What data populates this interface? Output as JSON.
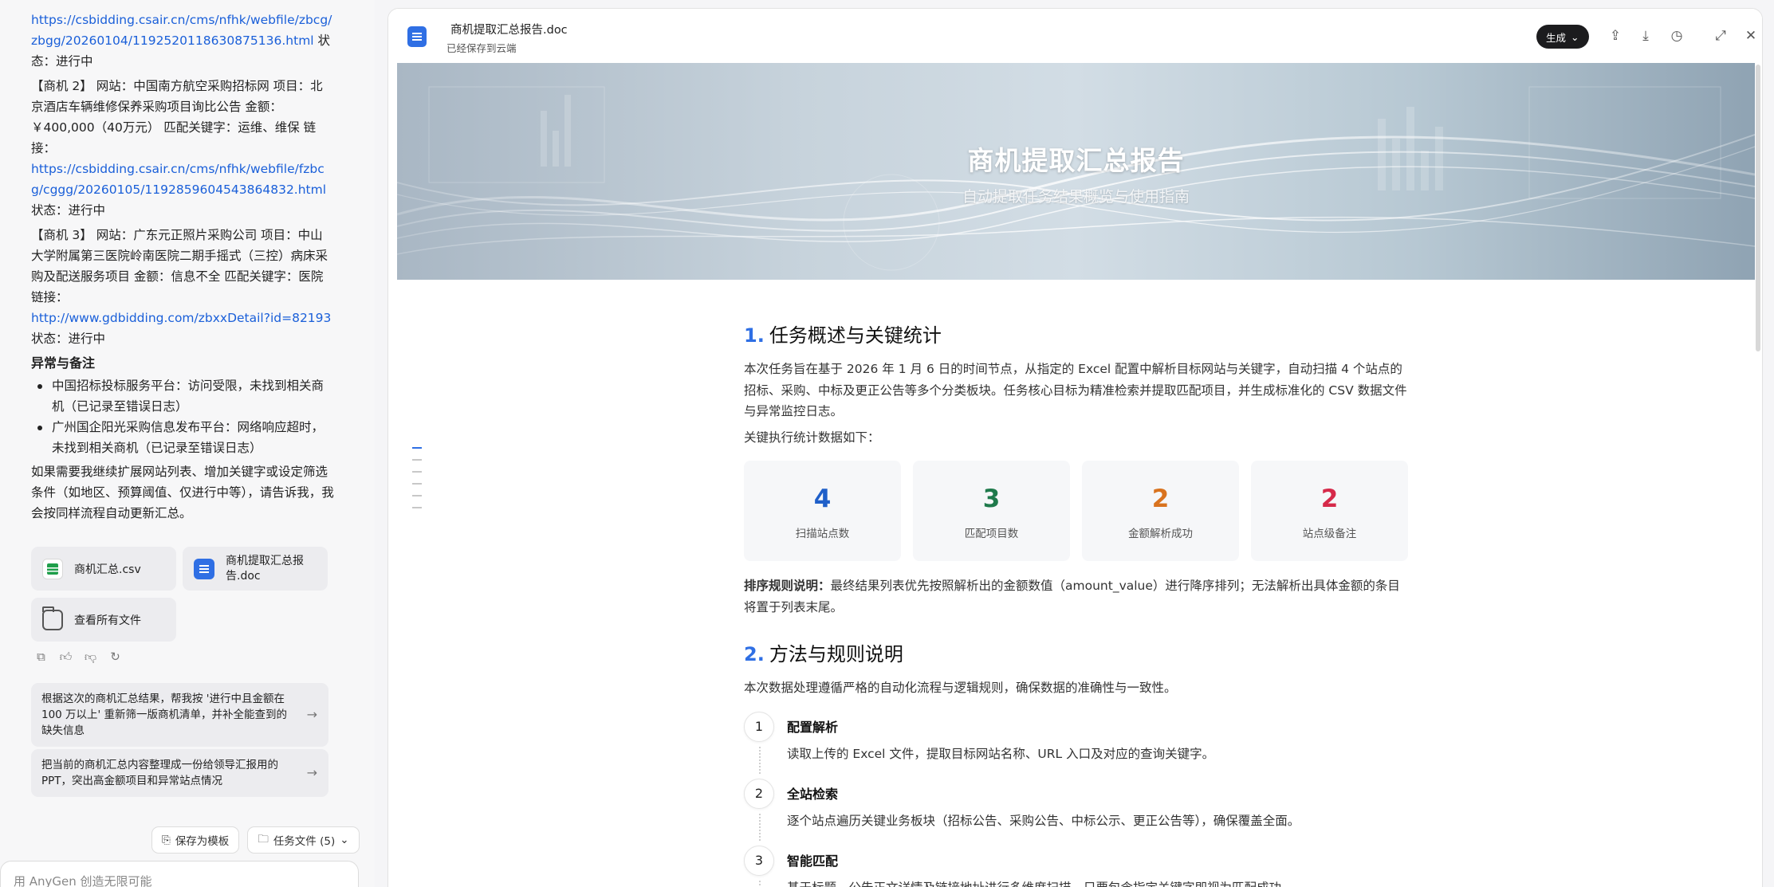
{
  "chat": {
    "link1": "https://csbidding.csair.cn/cms/nfhk/webfile/zbcg/zbgg/20260104/1192520118630875136.html",
    "link1_suffix": " 状态：进行中",
    "opp2_text": "【商机 2】 网站：中国南方航空采购招标网 项目：北京酒店车辆维修保养采购项目询比公告 金额：￥400,000（40万元） 匹配关键字：运维、维保 链接：",
    "link2": "https://csbidding.csair.cn/cms/nfhk/webfile/fzbcg/cggg/20260105/1192859604543864832.html",
    "opp2_status": "状态：进行中",
    "opp3_text": "【商机 3】 网站：广东元正照片采购公司 项目：中山大学附属第三医院岭南医院二期手摇式（三控）病床采购及配送服务项目 金额：信息不全 匹配关键字：医院 链接：",
    "link3": "http://www.gdbidding.com/zbxxDetail?id=82193",
    "opp3_status": "状态：进行中",
    "exceptions_title": "异常与备注",
    "exceptions": [
      "中国招标投标服务平台：访问受限，未找到相关商机（已记录至错误日志）",
      "广州国企阳光采购信息发布平台：网络响应超时，未找到相关商机（已记录至错误日志）"
    ],
    "closing": "如果需要我继续扩展网站列表、增加关键字或设定筛选条件（如地区、预算阈值、仅进行中等），请告诉我，我会按同样流程自动更新汇总。"
  },
  "files": {
    "csv": "商机汇总.csv",
    "doc": "商机提取汇总报告.doc",
    "all": "查看所有文件"
  },
  "suggestions": [
    "根据这次的商机汇总结果，帮我按 '进行中且金额在 100 万以上' 重新筛一版商机清单，并补全能查到的缺失信息",
    "把当前的商机汇总内容整理成一份给领导汇报用的 PPT，突出高金额项目和异常站点情况"
  ],
  "bottom": {
    "save_template": "保存为模板",
    "task_files": "任务文件 (5)",
    "input_placeholder": "用 AnyGen 创造无限可能"
  },
  "doc": {
    "filename": "商机提取汇总报告.doc",
    "saved": "已经保存到云端",
    "generate": "生成",
    "banner_title": "商机提取汇总报告",
    "banner_subtitle": "自动提取任务结果概览与使用指南",
    "s1_num": "1.",
    "s1_title": "任务概述与关键统计",
    "s1_para": "本次任务旨在基于 2026 年 1 月 6 日的时间节点，从指定的 Excel 配置中解析目标网站与关键字，自动扫描 4 个站点的招标、采购、中标及更正公告等多个分类板块。任务核心目标为精准检索并提取匹配项目，并生成标准化的 CSV 数据文件与异常监控日志。",
    "s1_lead": "关键执行统计数据如下：",
    "stats": [
      {
        "value": "4",
        "label": "扫描站点数",
        "color": "#1f5fc9"
      },
      {
        "value": "3",
        "label": "匹配项目数",
        "color": "#1f7a4c"
      },
      {
        "value": "2",
        "label": "金额解析成功",
        "color": "#d9731f"
      },
      {
        "value": "2",
        "label": "站点级备注",
        "color": "#d62a4a"
      }
    ],
    "sort_label": "排序规则说明：",
    "sort_text": "最终结果列表优先按照解析出的金额数值（amount_value）进行降序排列；无法解析出具体金额的条目将置于列表末尾。",
    "s2_num": "2.",
    "s2_title": "方法与规则说明",
    "s2_para": "本次数据处理遵循严格的自动化流程与逻辑规则，确保数据的准确性与一致性。",
    "steps": [
      {
        "n": "1",
        "title": "配置解析",
        "desc": "读取上传的 Excel 文件，提取目标网站名称、URL 入口及对应的查询关键字。"
      },
      {
        "n": "2",
        "title": "全站检索",
        "desc": "逐个站点遍历关键业务板块（招标公告、采购公告、中标公示、更正公告等），确保覆盖全面。"
      },
      {
        "n": "3",
        "title": "智能匹配",
        "desc": "基于标题、公告正文详情及链接地址进行多维度扫描，只要包含指定关键字即视为匹配成功。"
      }
    ]
  }
}
